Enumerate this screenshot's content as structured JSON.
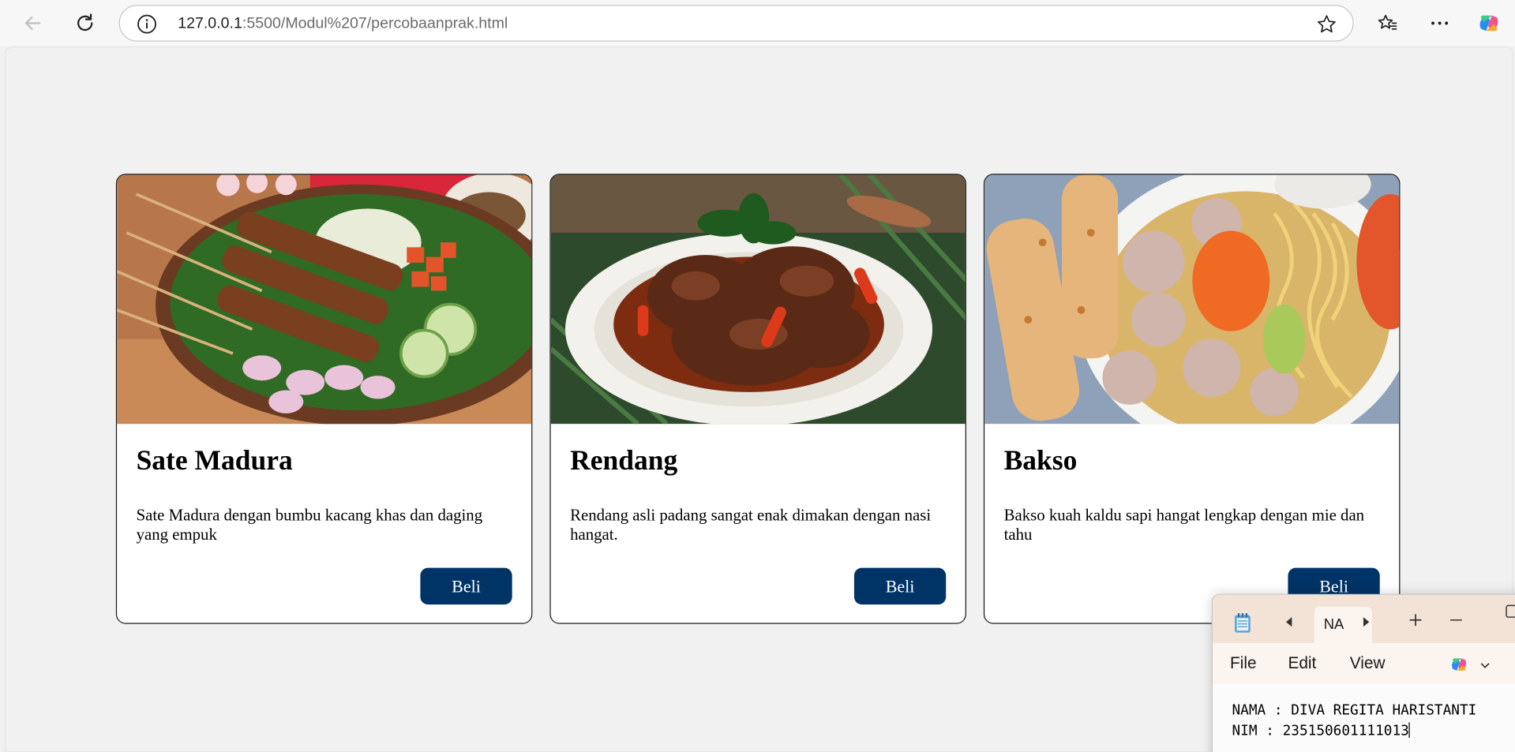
{
  "browser": {
    "url_host": "127.0.0.1",
    "url_rest": ":5500/Modul%207/percobaanprak.html"
  },
  "cards": [
    {
      "title": "Sate Madura",
      "desc": "Sate Madura dengan bumbu kacang khas dan daging yang empuk",
      "button": "Beli"
    },
    {
      "title": "Rendang",
      "desc": "Rendang asli padang sangat enak dimakan dengan nasi hangat.",
      "button": "Beli"
    },
    {
      "title": "Bakso",
      "desc": "Bakso kuah kaldu sapi hangat lengkap dengan mie dan tahu",
      "button": "Beli"
    }
  ],
  "notepad": {
    "tab_label": "NA",
    "menu": [
      "File",
      "Edit",
      "View"
    ],
    "line1": "NAMA : DIVA REGITA HARISTANTI",
    "line2": "NIM : 235150601111013"
  }
}
